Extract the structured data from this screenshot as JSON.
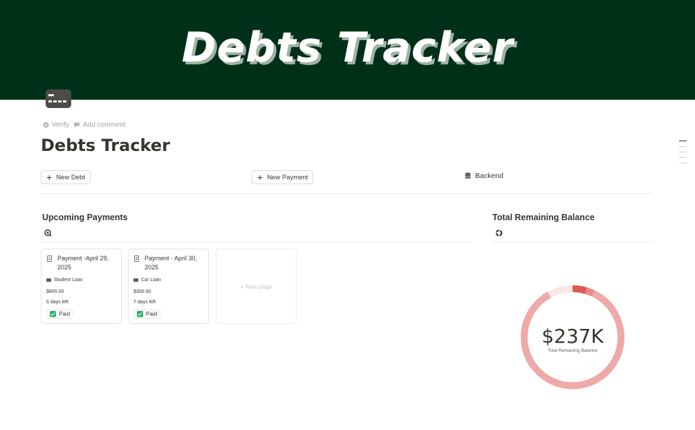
{
  "cover": {
    "title": "Debts Tracker",
    "background": "#013018"
  },
  "page_icon": "credit-card-icon",
  "meta": {
    "verify_label": "Verify",
    "comment_label": "Add comment"
  },
  "page": {
    "title": "Debts Tracker"
  },
  "actions": {
    "new_debt": "New Debt",
    "new_payment": "New Payment",
    "backend": "Backend"
  },
  "upcoming": {
    "title": "Upcoming Payments",
    "view_icon": "gallery-view-icon",
    "cards": [
      {
        "title": "Payment -April 29, 2025",
        "debt": "Student Loan",
        "amount": "$800.00",
        "days_left": "5 days left",
        "status": "Paid"
      },
      {
        "title": "Payment - April 30, 2025",
        "debt": "Car Loan",
        "amount": "$300.00",
        "days_left": "7 days left",
        "status": "Paid"
      }
    ],
    "new_page_label": "+ New page"
  },
  "balance": {
    "title": "Total Remaining Balance",
    "view_icon": "donut-chart-icon",
    "value": "$237K",
    "label": "Total Remaining Balance"
  },
  "chart_data": {
    "type": "pie",
    "style": "donut",
    "center_value": "$237K",
    "center_label": "Total Remaining Balance",
    "slices": [
      {
        "value": 85,
        "color": "#eea9a9"
      },
      {
        "value": 8,
        "color": "#fbe6e6"
      },
      {
        "value": 4.5,
        "color": "#de5a53"
      },
      {
        "value": 2.5,
        "color": "#e88a86"
      }
    ]
  },
  "colors": {
    "accent_green": "#2ab36a",
    "donut_main": "#eea9a9",
    "donut_dark": "#de5a53"
  }
}
